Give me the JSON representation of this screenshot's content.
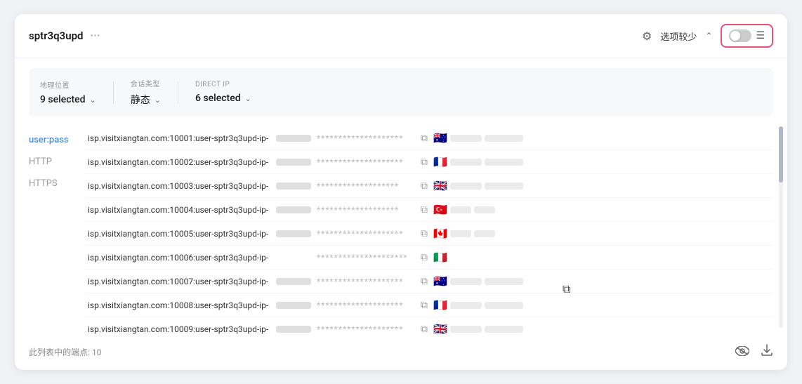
{
  "header": {
    "title": "sptr3q3upd",
    "dots_label": "···",
    "options_label": "选项较少",
    "gear_icon": "⚙",
    "chevron_up": "∧"
  },
  "toggle": {
    "menu_icon": "☰"
  },
  "filters": {
    "geo_label": "地理位置",
    "geo_value": "9 selected",
    "session_label": "会话类型",
    "session_value": "静态",
    "direct_ip_label": "DIRECT IP",
    "direct_ip_value": "6 selected"
  },
  "nav": {
    "items": [
      {
        "id": "userpass",
        "label": "user:pass",
        "active": true
      },
      {
        "id": "http",
        "label": "HTTP",
        "active": false
      },
      {
        "id": "https",
        "label": "HTTPS",
        "active": false
      }
    ]
  },
  "proxy_rows": [
    {
      "url": "isp.visitxiangtan.com:10001:user-sptr3q3upd-ip-",
      "password": "********************",
      "flag": "🇦🇺",
      "row": 1
    },
    {
      "url": "isp.visitxiangtan.com:10002:user-sptr3q3upd-ip-",
      "password": "********************",
      "flag": "🇫🇷",
      "row": 2
    },
    {
      "url": "isp.visitxiangtan.com:10003:user-sptr3q3upd-ip-",
      "password": "********************",
      "flag": "🇬🇧",
      "row": 3
    },
    {
      "url": "isp.visitxiangtan.com:10004:user-sptr3q3upd-ip-",
      "password": "*******************",
      "flag": "🇹🇷",
      "row": 4
    },
    {
      "url": "isp.visitxiangtan.com:10005:user-sptr3q3upd-ip-",
      "password": "********************",
      "flag": "🇨🇦",
      "row": 5
    },
    {
      "url": "isp.visitxiangtan.com:10006:user-sptr3q3upd-ip-",
      "password": "*********************",
      "flag": "🇮🇹",
      "row": 6
    },
    {
      "url": "isp.visitxiangtan.com:10007:user-sptr3q3upd-ip-",
      "password": "********************",
      "flag": "🇦🇺",
      "row": 7
    },
    {
      "url": "isp.visitxiangtan.com:10008:user-sptr3q3upd-ip-",
      "password": "********************",
      "flag": "🇫🇷",
      "row": 8
    },
    {
      "url": "isp.visitxiangtan.com:10009:user-sptr3q3upd-ip-",
      "password": "********************",
      "flag": "🇬🇧",
      "row": 9
    }
  ],
  "footer": {
    "count_label": "此列表中的端点: 10",
    "eye_icon": "👁",
    "download_icon": "⬇"
  }
}
